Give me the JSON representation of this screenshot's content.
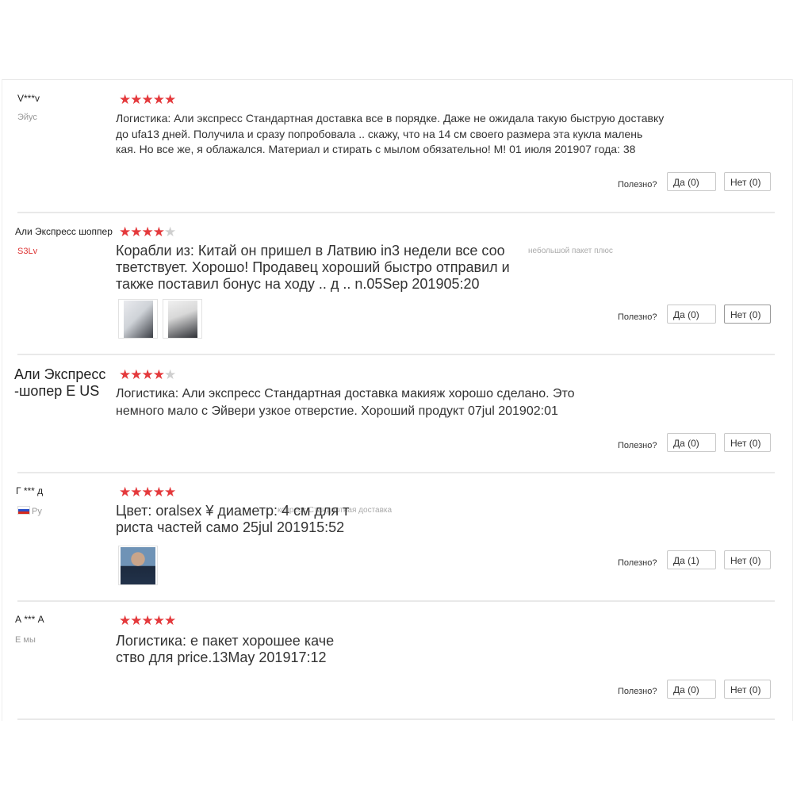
{
  "ui": {
    "helpful_label": "Полезно?"
  },
  "reviews": [
    {
      "user": "V***v",
      "country": "Эйус",
      "rating": 5,
      "text": "Логистика: Али экспресс Стандартная доставка все в порядке. Даже не ожидала такую быструю доставку\nдо ufa13 дней. Получила и сразу попробовала .. скажу, что на 14 см своего размера эта кукла малень\nкая. Но все же, я облажался. Материал и стирать с мылом обязательно! М! 01 июля 201907 года: 38",
      "yes": "Да (0)",
      "no": "Нет (0)"
    },
    {
      "user": "Али Экспресс шоппер",
      "country": "S3Lv",
      "rating": 4,
      "text": "Корабли из: Китай он пришел в Латвию in3 недели все соо\nтветствует. Хорошо! Продавец хороший быстро отправил и\nтакже поставил бонус на ходу .. д .. n.05Sep 201905:20",
      "ghost": "небольшой пакет плюс",
      "yes": "Да (0)",
      "no": "Нет (0)"
    },
    {
      "user": "Али Экспресс\n-шопер E US",
      "rating": 4,
      "text": "Логистика: Али экспресс Стандартная доставка макияж хорошо сделано. Это\nнемного мало с Эйвери узкое отверстие. Хороший продукт 07jul 201902:01",
      "yes": "Да (0)",
      "no": "Нет (0)"
    },
    {
      "user": "Г *** д",
      "country": "Ру",
      "rating": 5,
      "text": "Цвет: oralsex ¥ диаметр: 4 см для т\nриста частей само 25jul 201915:52",
      "ghost": "кспресс Стандартная доставка",
      "yes": "Да (1)",
      "no": "Нет (0)"
    },
    {
      "user": "А *** А",
      "country": "E мы",
      "rating": 5,
      "text": "Логистика: е пакет хорошее каче\nство для price.13May 201917:12",
      "yes": "Да (0)",
      "no": "Нет (0)"
    }
  ]
}
